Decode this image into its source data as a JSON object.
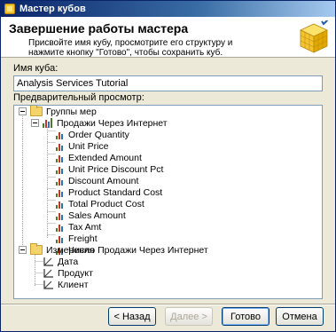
{
  "window": {
    "title": "Мастер кубов"
  },
  "header": {
    "title": "Завершение работы мастера",
    "description": "Присвойте имя кубу, просмотрите его структуру и нажмите кнопку \"Готово\", чтобы сохранить куб."
  },
  "form": {
    "cube_name_label": "Имя куба:",
    "cube_name_value": "Analysis Services Tutorial",
    "preview_label": "Предварительный просмотр:"
  },
  "tree": {
    "measure_groups_label": "Группы мер",
    "measure_group": "Продажи Через Интернет",
    "measures": [
      "Order Quantity",
      "Unit Price",
      "Extended Amount",
      "Unit Price Discount Pct",
      "Discount Amount",
      "Product Standard Cost",
      "Total Product Cost",
      "Sales Amount",
      "Tax Amt",
      "Freight",
      "Число Продажи Через Интернет"
    ],
    "dimensions_label": "Измерения",
    "dimensions": [
      "Дата",
      "Продукт",
      "Клиент"
    ]
  },
  "buttons": {
    "back": "< Назад",
    "next": "Далее >",
    "finish": "Готово",
    "cancel": "Отмена"
  },
  "colors": {
    "title_bar": "#0a246a",
    "folder": "#f5d36b",
    "cube": "#f4c430"
  }
}
